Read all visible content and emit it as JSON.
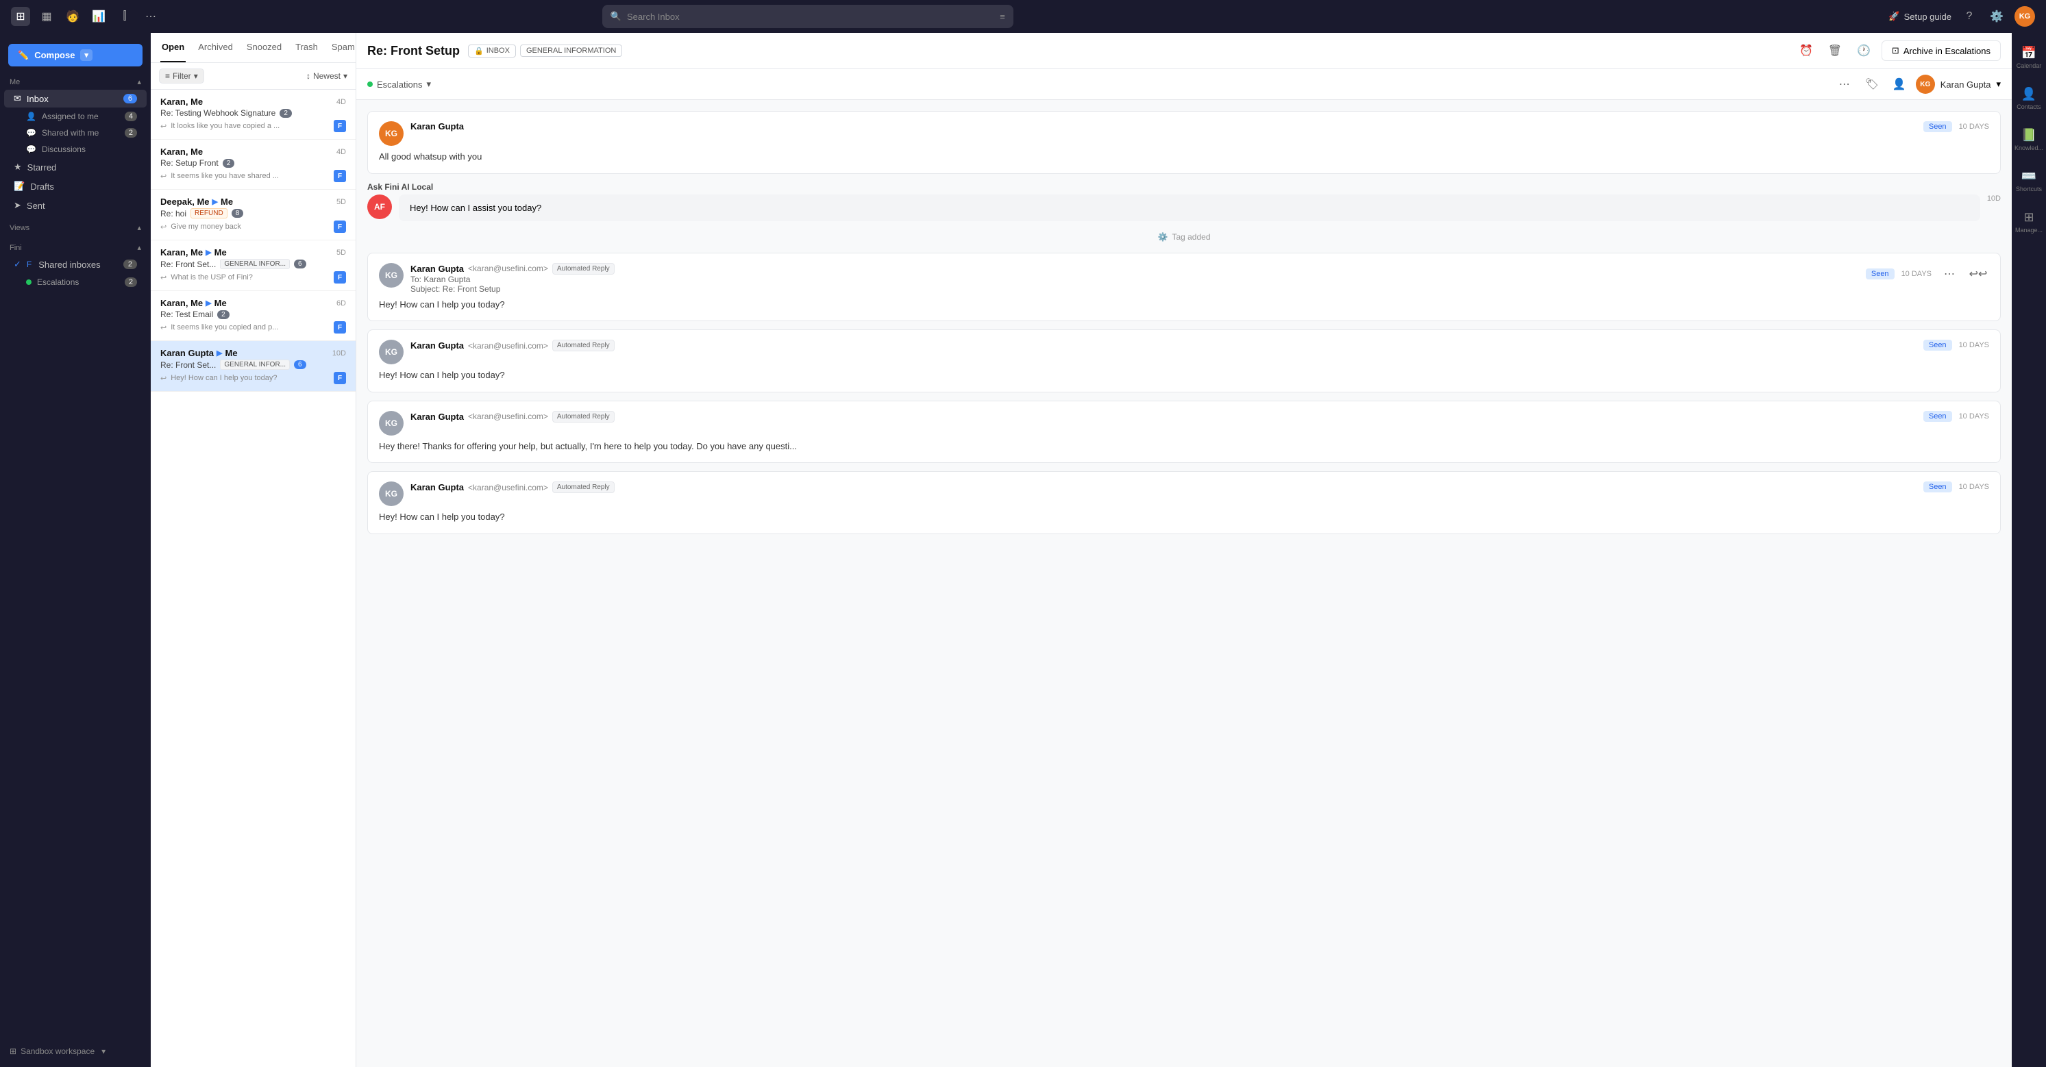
{
  "topbar": {
    "search_placeholder": "Search Inbox",
    "setup_guide_label": "Setup guide",
    "avatar_initials": "KG",
    "icons": [
      "grid-icon",
      "calendar-icon",
      "user-icon",
      "bar-icon",
      "columns-icon",
      "more-icon"
    ]
  },
  "sidebar": {
    "compose_label": "Compose",
    "me_section": "Me",
    "inbox_label": "Inbox",
    "inbox_count": "6",
    "assigned_to_me_label": "Assigned to me",
    "assigned_count": "4",
    "shared_with_me_label": "Shared with me",
    "shared_count": "2",
    "discussions_label": "Discussions",
    "starred_label": "Starred",
    "drafts_label": "Drafts",
    "sent_label": "Sent",
    "views_section": "Views",
    "fini_section": "Fini",
    "shared_inboxes_label": "Shared inboxes",
    "shared_inboxes_count": "2",
    "escalations_label": "Escalations",
    "escalations_count": "2",
    "sandbox_workspace_label": "Sandbox workspace"
  },
  "thread_list": {
    "tabs": [
      "Open",
      "Archived",
      "Snoozed",
      "Trash",
      "Spam"
    ],
    "active_tab": "Open",
    "filter_label": "Filter",
    "newest_label": "Newest",
    "threads": [
      {
        "id": "t1",
        "sender": "Karan, Me",
        "date": "4D",
        "subject": "Re: Testing Webhook Signature",
        "count": "2",
        "preview": "It looks like you have copied a ...",
        "tags": []
      },
      {
        "id": "t2",
        "sender": "Karan, Me",
        "date": "4D",
        "subject": "Re: Setup Front",
        "count": "2",
        "preview": "It seems like you have shared ...",
        "tags": []
      },
      {
        "id": "t3",
        "sender": "Deepak, Me",
        "date": "5D",
        "subject": "Re: hoi",
        "count": "8",
        "preview": "Give my money back",
        "tags": [
          "REFUND"
        ],
        "arrow_to": "Me"
      },
      {
        "id": "t4",
        "sender": "Karan, Me",
        "date": "5D",
        "subject": "Re: Front Set...",
        "count": "6",
        "preview": "What is the USP of Fini?",
        "tags": [
          "GENERAL INFOR..."
        ],
        "arrow_to": "Me"
      },
      {
        "id": "t5",
        "sender": "Karan, Me",
        "date": "6D",
        "subject": "Re: Test Email",
        "count": "2",
        "preview": "It seems like you copied and p...",
        "tags": [],
        "arrow_to": "Me"
      },
      {
        "id": "t6",
        "sender": "Karan Gupta",
        "date": "10D",
        "subject": "Re: Front Set...",
        "count": "6",
        "preview": "Hey! How can I help you today?",
        "tags": [
          "GENERAL INFOR..."
        ],
        "arrow_to": "Me",
        "selected": true
      }
    ]
  },
  "conversation": {
    "title": "Re: Front Setup",
    "tags": [
      "INBOX",
      "GENERAL INFORMATION"
    ],
    "channel_label": "INBOX",
    "channel_icon": "lock-icon",
    "info_tag": "GENERAL INFORMATION",
    "archive_label": "Archive in Escalations",
    "escalations_inbox": "Escalations",
    "assignee": "Karan Gupta",
    "messages": [
      {
        "id": "m1",
        "avatar_initials": "KG",
        "avatar_color": "orange",
        "sender_name": "Karan Gupta",
        "body": "All good whatsup with you",
        "seen": true,
        "time": "10 DAYS",
        "type": "normal"
      },
      {
        "id": "m2",
        "avatar_initials": "AF",
        "avatar_color": "red",
        "sender_name": "Ask Fini AI Local",
        "body": "Hey! How can I assist you today?",
        "seen": false,
        "time": "10D",
        "type": "ai"
      },
      {
        "id": "m3",
        "tag_event": "Tag added"
      },
      {
        "id": "m4",
        "avatar_initials": "KG",
        "avatar_color": "gray",
        "sender_name": "Karan Gupta",
        "sender_email": "<karan@usefini.com>",
        "auto_reply": "Automated Reply",
        "to": "To: Karan Gupta",
        "subject_line": "Subject: Re: Front Setup",
        "body": "Hey! How can I help you today?",
        "seen": true,
        "time": "10 DAYS",
        "type": "email"
      },
      {
        "id": "m5",
        "avatar_initials": "KG",
        "avatar_color": "gray",
        "sender_name": "Karan Gupta",
        "sender_email": "<karan@usefini.com>",
        "auto_reply": "Automated Reply",
        "body": "Hey! How can I help you today?",
        "seen": true,
        "time": "10 DAYS",
        "type": "email-simple"
      },
      {
        "id": "m6",
        "avatar_initials": "KG",
        "avatar_color": "gray",
        "sender_name": "Karan Gupta",
        "sender_email": "<karan@usefini.com>",
        "auto_reply": "Automated Reply",
        "body": "Hey there! Thanks for offering your help, but actually, I'm here to help you today. Do you have any questi...",
        "seen": true,
        "time": "10 DAYS",
        "type": "email-simple"
      },
      {
        "id": "m7",
        "avatar_initials": "KG",
        "avatar_color": "gray",
        "sender_name": "Karan Gupta",
        "sender_email": "<karan@usefini.com>",
        "auto_reply": "Automated Reply",
        "body": "Hey! How can I help you today?",
        "seen": true,
        "time": "10 DAYS",
        "type": "email-simple"
      }
    ]
  },
  "right_panel": {
    "items": [
      {
        "icon": "📅",
        "label": "Calendar"
      },
      {
        "icon": "👤",
        "label": "Contacts"
      },
      {
        "icon": "📗",
        "label": "Knowled..."
      },
      {
        "icon": "⌨️",
        "label": "Shortcuts"
      },
      {
        "icon": "⊞",
        "label": "Manage..."
      }
    ]
  }
}
